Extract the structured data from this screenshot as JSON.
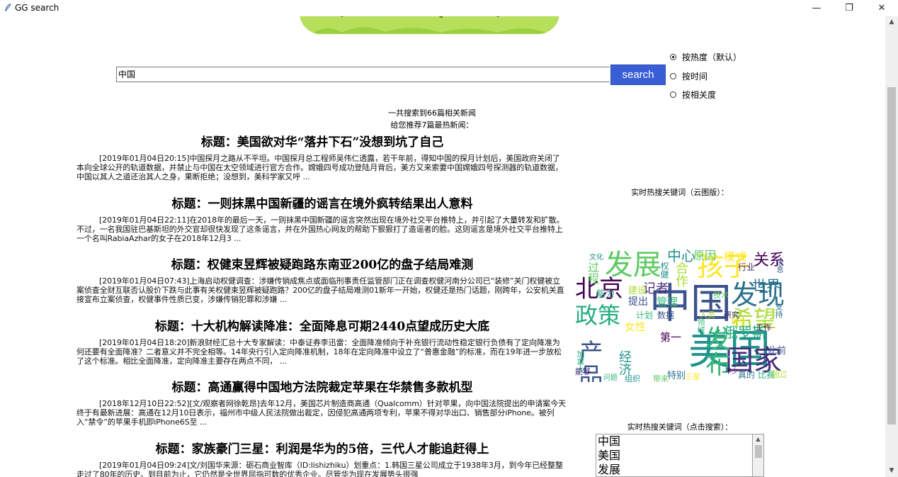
{
  "window": {
    "title": "GG search",
    "minimize": "—",
    "restore": "❐",
    "close": "✕"
  },
  "search": {
    "value": "中国",
    "button_label": "search"
  },
  "sort_options": [
    {
      "label": "按热度（默认）",
      "selected": true
    },
    {
      "label": "按时间",
      "selected": false
    },
    {
      "label": "按相关度",
      "selected": false
    }
  ],
  "summary": {
    "total": "一共搜索到66篇相关新闻",
    "recommend": "给您推荐7篇最热新闻："
  },
  "news": [
    {
      "title": "标题：美国欲对华“落井下石”没想到坑了自己",
      "body": "[2019年01月04日20:15]中国探月之路从不平坦。中国探月总工程师吴伟仁透露，若干年前，得知中国的探月计划后，美国政府关闭了本向全球公开的轨道数据，并禁止与中国在太空领域进行官方合作。嫦娥四号成功登陆月背后，美方又来索要中国嫦娥四号探测器的轨道数据，中国以其人之道还治其人之身，果断拒绝；没想到，美科学家又呼 ..."
    },
    {
      "title": "标题：一则抹黑中国新疆的谣言在境外疯转结果出人意料",
      "body": "[2019年01月04日22:11]在2018年的最后一天，一则抹黑中国新疆的谣言突然出现在境外社交平台推特上，并引起了大量转发和扩散。不过，一名我国驻巴基斯坦的外交官却很快发现了这条谣言，并在外国热心网友的帮助下狠狠打了造谣者的脸。这则谣言是境外社交平台推特上一个名叫RabiaAzhar的女子在2018年12月3 ..."
    },
    {
      "title": "标题：权健束昱辉被疑跑路东南亚200亿的盘子结局难测",
      "body": "[2019年01月04日07:43]上海启动权健调查：涉嫌传销成焦点或面临刑事责任监管部门正在调查权健河南分公司已“装修”关门权健被立案侦查全财互联否认股价下跌与此事有关权健束昱辉被疑跑路？200亿的盘子结局难测01新年一开始，权健还是热门话题，刚跨年，公安机关直接宣布立案侦查，权健事件性质已变，涉嫌传销犯罪和涉嫌 ..."
    },
    {
      "title": "标题：十大机构解读降准：全面降息可期2440点望成历史大底",
      "body": "[2019年01月04日18:20]新浪财经汇总十大专家解读：中泰证券李迅雷：全面降准倾向于补充银行流动性稳定银行负债有了定向降准为何还要有全面降准？二者意义并不完全相等。14年央行引入定向降准机制，18年在定向降准中设立了“普惠金融”的标准，而在19年进一步放松了这个标准。相比全面降准，定向降准主要存在两点不同， ..."
    },
    {
      "title": "标题：高通赢得中国地方法院裁定苹果在华禁售多款机型",
      "body": "[2018年12月10日22:52][文/观察者网徐乾昂]去年12月，美国芯片制造商高通（Qualcomm）针对苹果，向中国法院提出的申请案今天终于有最新进展：高通在12月10日表示，福州市中级人民法院做出裁定，因侵犯高通两项专利，苹果不得对华出口、销售部分iPhone。被列入“禁令”的苹果手机即iPhone6S至 ..."
    },
    {
      "title": "标题：家族豪门三星：利润是华为的5倍，三代人才能追赶得上",
      "body": "[2019年01月04日09:24]文/刘国华来源：砺石商业智库（ID:lishizhiku）划重点：1.韩国三星公司成立于1938年3月，到今年已经整整走过了80年的历史。到目前为止，它仍然是全世界屈指可数的优秀企业。尽管华为现在发展势头很强"
    }
  ],
  "wordcloud": {
    "label": "实时热搜关键词（云图版）：",
    "words": [
      "中国",
      "美国",
      "发展",
      "孩子",
      "北京",
      "发现",
      "政策",
      "希望",
      "国家",
      "发布",
      "产品",
      "中心",
      "原因",
      "模式",
      "关系",
      "世界",
      "俄罗斯",
      "合作",
      "记者",
      "管理",
      "提出",
      "经济",
      "过程",
      "女性",
      "第一",
      "特别",
      "能力",
      "建设",
      "行业",
      "计划",
      "数据",
      "权健",
      "技术",
      "学生",
      "工作",
      "支持",
      "加拿大",
      "人员",
      "研究",
      "领域",
      "此前",
      "组织",
      "带来",
      "三星",
      "不少",
      "真的",
      "比赛",
      "超过",
      "能够",
      "问题",
      "信息",
      "文化"
    ]
  },
  "hot_list": {
    "label": "实时热搜关键词（点击搜索）：",
    "items": [
      "中国",
      "美国",
      "发展"
    ]
  }
}
